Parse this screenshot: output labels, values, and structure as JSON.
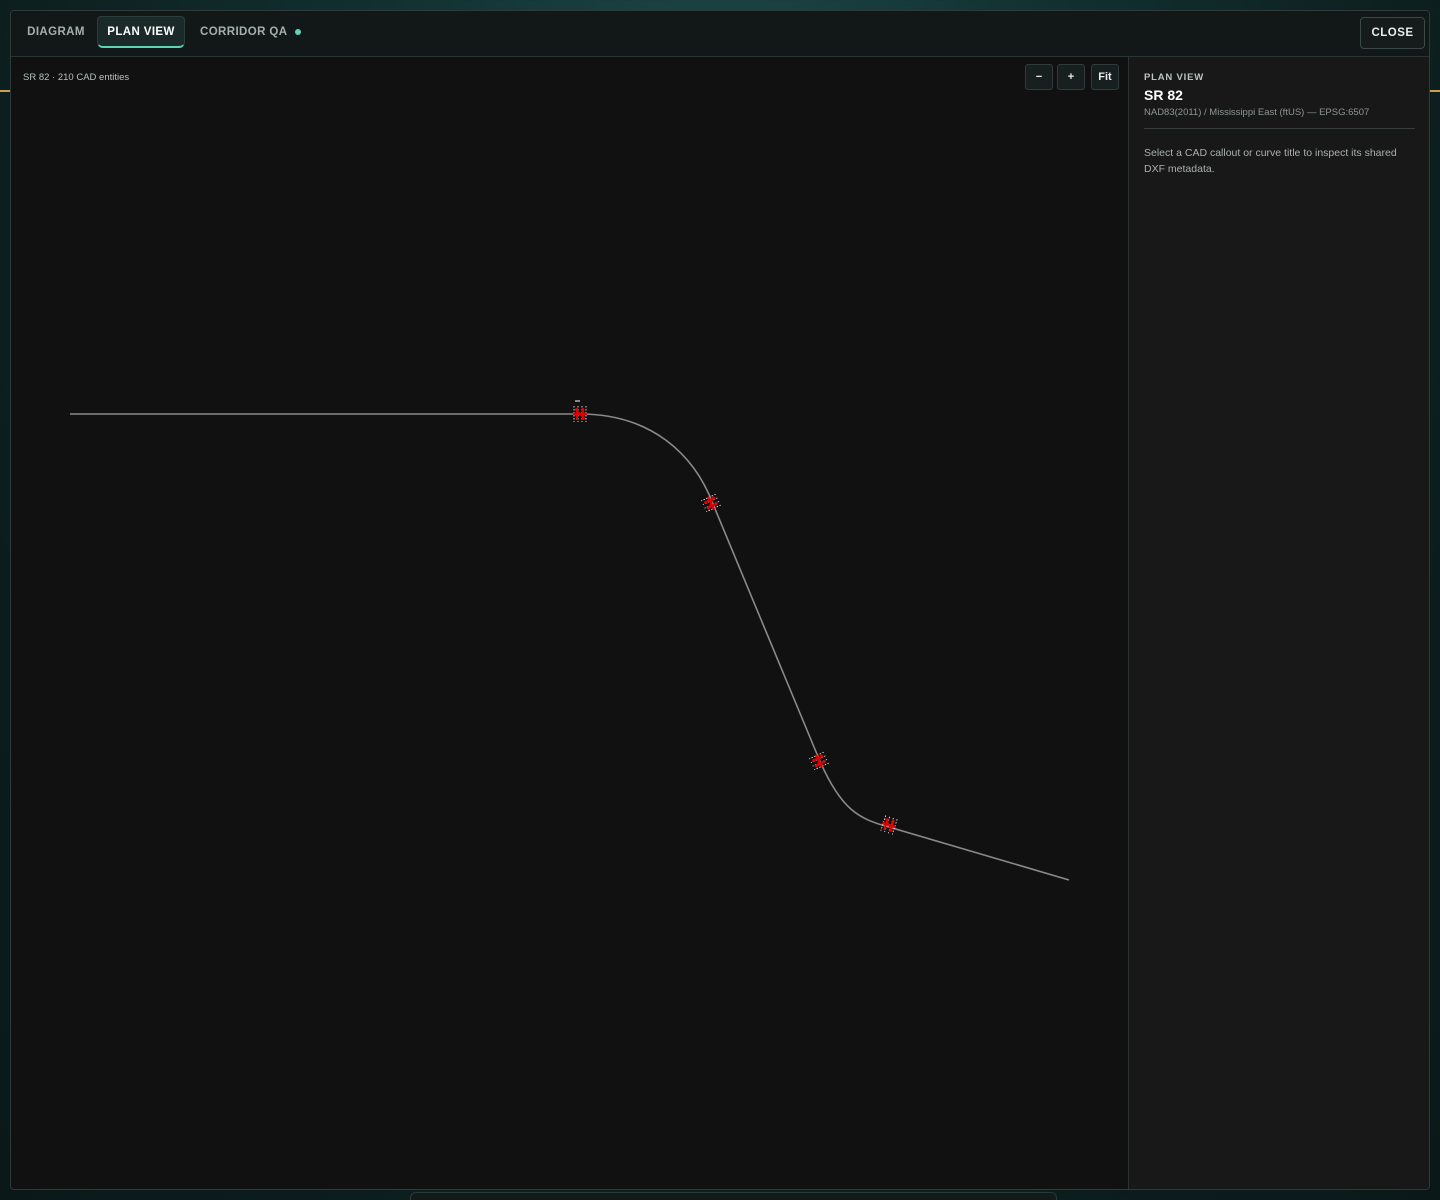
{
  "tabs": [
    {
      "label": "DIAGRAM",
      "active": false
    },
    {
      "label": "PLAN VIEW",
      "active": true
    },
    {
      "label": "CORRIDOR QA",
      "active": false,
      "status_dot": true
    }
  ],
  "close_label": "CLOSE",
  "canvas": {
    "entity_count_label": "SR 82 · 210 CAD entities",
    "zoom_controls": {
      "out_label": "−",
      "in_label": "+",
      "fit_label": "Fit"
    },
    "alignment_color": "#8a8a8a",
    "marker_color": "#e00000"
  },
  "side_panel": {
    "kicker": "PLAN VIEW",
    "title": "SR 82",
    "crs": "NAD83(2011) / Mississippi East (ftUS) — EPSG:6507",
    "hint": "Select a CAD callout or curve title to inspect its shared DXF metadata."
  },
  "colors": {
    "accent": "#5fd3b8",
    "panel_bg": "#181818",
    "canvas_bg": "#111111"
  }
}
